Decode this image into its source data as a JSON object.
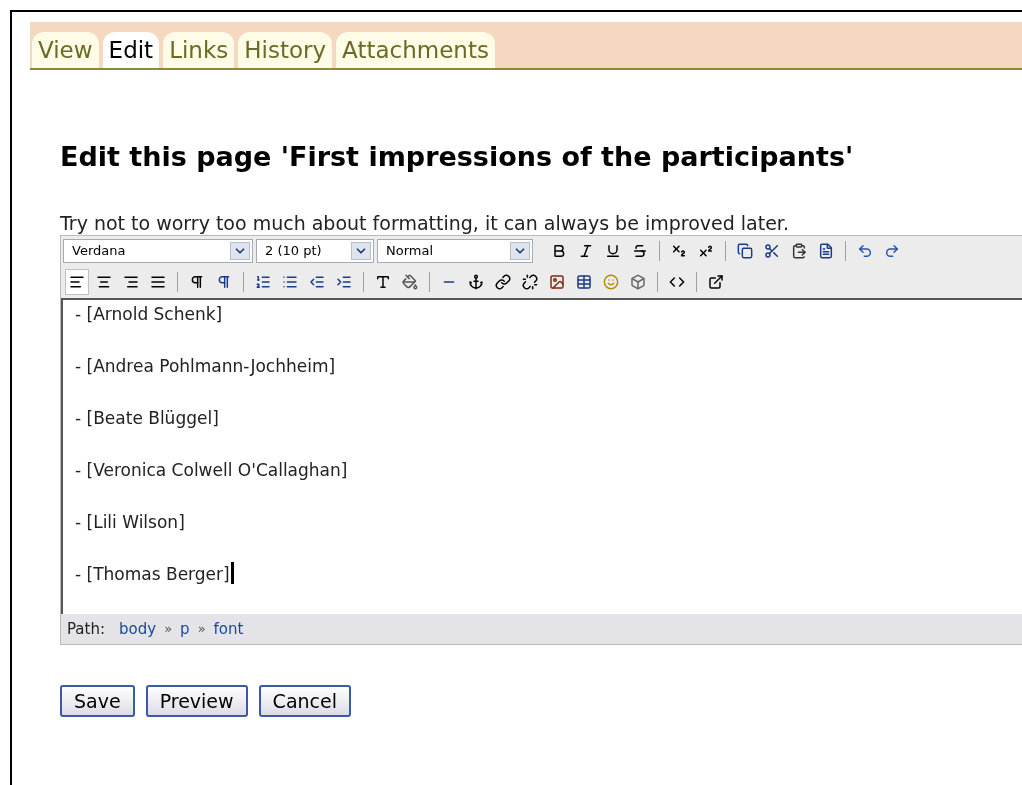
{
  "tabs": [
    {
      "label": "View",
      "selected": false
    },
    {
      "label": "Edit",
      "selected": true
    },
    {
      "label": "Links",
      "selected": false
    },
    {
      "label": "History",
      "selected": false
    },
    {
      "label": "Attachments",
      "selected": false
    }
  ],
  "heading": "Edit this page 'First impressions of the participants'",
  "hint": "Try not to worry too much about formatting, it can always be improved later.",
  "editor": {
    "font": "Verdana",
    "size": "2 (10 pt)",
    "format": "Normal",
    "alignment": [
      {
        "selected": true
      },
      {
        "selected": false
      },
      {
        "selected": false
      },
      {
        "selected": false
      }
    ],
    "lines": [
      "- [Arnold Schenk]",
      "- [Andrea Pohlmann-Jochheim]",
      "- [Beate Blüggel]",
      "- [Veronica Colwell O'Callaghan]",
      "- [Lili Wilson]",
      "- [Thomas Berger]"
    ],
    "path_label": "Path:",
    "path": [
      "body",
      "p",
      "font"
    ],
    "path_separator": "»"
  },
  "buttons": [
    "Save",
    "Preview",
    "Cancel"
  ]
}
